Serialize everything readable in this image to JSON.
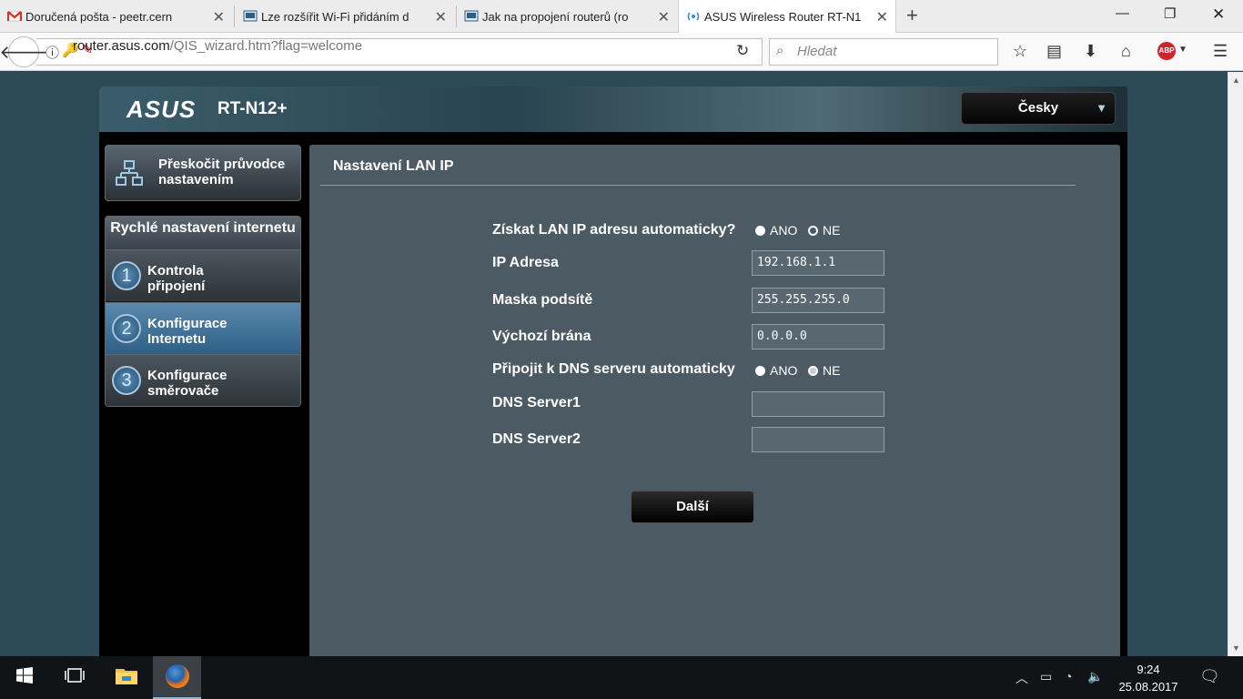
{
  "browser": {
    "tabs": [
      {
        "title": "Doručená pošta - peetr.cern",
        "icon": "gmail-icon"
      },
      {
        "title": "Lze rozšířit Wi-Fi přidáním d",
        "icon": "page-icon"
      },
      {
        "title": "Jak na propojení routerů (ro",
        "icon": "page-icon"
      },
      {
        "title": "ASUS Wireless Router RT-N1",
        "icon": "wireless-icon"
      }
    ],
    "url_host": "router.asus.com",
    "url_path": "/QIS_wizard.htm?flag=welcome",
    "search_placeholder": "Hledat",
    "abp_label": "ABP"
  },
  "router": {
    "logo": "ASUS",
    "model": "RT-N12+",
    "language": "Česky",
    "skip_wizard": "Přeskočit průvodce nastavením",
    "quick_setup_title": "Rychlé nastavení internetu",
    "steps": [
      {
        "num": "1",
        "label": "Kontrola připojení"
      },
      {
        "num": "2",
        "label": "Konfigurace Internetu"
      },
      {
        "num": "3",
        "label": "Konfigurace směrovače"
      }
    ],
    "panel_title": "Nastavení LAN IP",
    "fields": {
      "auto_ip_label": "Získat LAN IP adresu automaticky?",
      "yes": "ANO",
      "no": "NE",
      "ip_label": "IP Adresa",
      "ip_value": "192.168.1.1",
      "mask_label": "Maska podsítě",
      "mask_value": "255.255.255.0",
      "gateway_label": "Výchozí brána",
      "gateway_value": "0.0.0.0",
      "auto_dns_label": "Připojit k DNS serveru automaticky",
      "dns1_label": "DNS Server1",
      "dns1_value": "",
      "dns2_label": "DNS Server2",
      "dns2_value": ""
    },
    "next_button": "Další"
  },
  "taskbar": {
    "time": "9:24",
    "date": "25.08.2017"
  }
}
